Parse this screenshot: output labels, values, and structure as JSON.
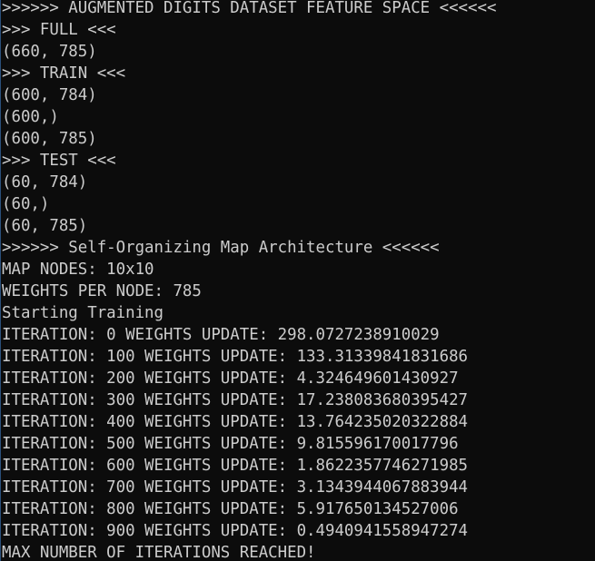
{
  "terminal": {
    "lines": [
      ">>>>>> AUGMENTED DIGITS DATASET FEATURE SPACE <<<<<<",
      ">>> FULL <<<",
      "(660, 785)",
      ">>> TRAIN <<<",
      "(600, 784)",
      "(600,)",
      "(600, 785)",
      ">>> TEST <<<",
      "(60, 784)",
      "(60,)",
      "(60, 785)",
      ">>>>>> Self-Organizing Map Architecture <<<<<<",
      "MAP NODES: 10x10",
      "WEIGHTS PER NODE: 785",
      "Starting Training",
      "ITERATION: 0 WEIGHTS UPDATE: 298.0727238910029",
      "ITERATION: 100 WEIGHTS UPDATE: 133.31339841831686",
      "ITERATION: 200 WEIGHTS UPDATE: 4.324649601430927",
      "ITERATION: 300 WEIGHTS UPDATE: 17.238083680395427",
      "ITERATION: 400 WEIGHTS UPDATE: 13.764235020322884",
      "ITERATION: 500 WEIGHTS UPDATE: 9.815596170017796",
      "ITERATION: 600 WEIGHTS UPDATE: 1.8622357746271985",
      "ITERATION: 700 WEIGHTS UPDATE: 3.1343944067883944",
      "ITERATION: 800 WEIGHTS UPDATE: 5.917650134527006",
      "ITERATION: 900 WEIGHTS UPDATE: 0.4940941558947274",
      "MAX NUMBER OF ITERATIONS REACHED!"
    ]
  }
}
